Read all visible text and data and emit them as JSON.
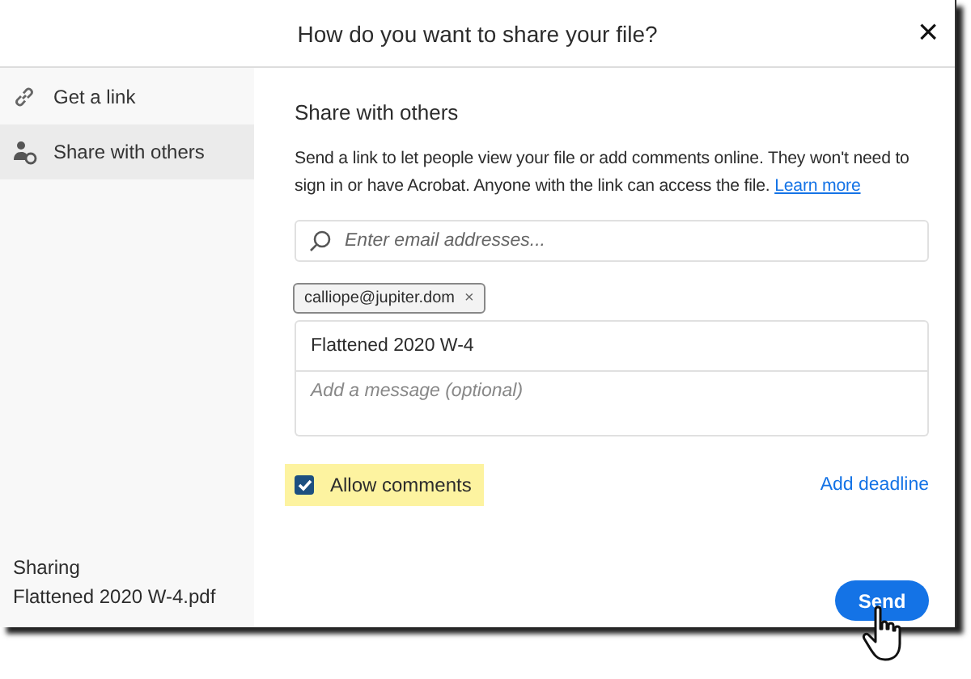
{
  "window": {
    "title": "How do you want to share your file?",
    "close": "×"
  },
  "sidebar": {
    "items": [
      {
        "label": "Get a link",
        "kind": "link",
        "selected": false
      },
      {
        "label": "Share with others",
        "kind": "people",
        "selected": true
      }
    ],
    "footer": {
      "caption": "Sharing",
      "file": "Flattened 2020 W-4.pdf"
    }
  },
  "main": {
    "heading": "Share with others",
    "description": "Send a link to let people view your file or add comments online. They won't need to sign in or have Acrobat. Anyone with the link can access the file.",
    "learn_more": "Learn more",
    "search": {
      "placeholder": "Enter email addresses..."
    },
    "recipients": [
      {
        "label": "calliope@jupiter.dom",
        "remove": "×"
      }
    ],
    "subject": "Flattened 2020 W-4",
    "message": {
      "placeholder": "Add a message (optional)"
    },
    "allow_comments": {
      "label": "Allow comments",
      "checked": true
    },
    "add_deadline": "Add deadline",
    "send": "Send"
  }
}
